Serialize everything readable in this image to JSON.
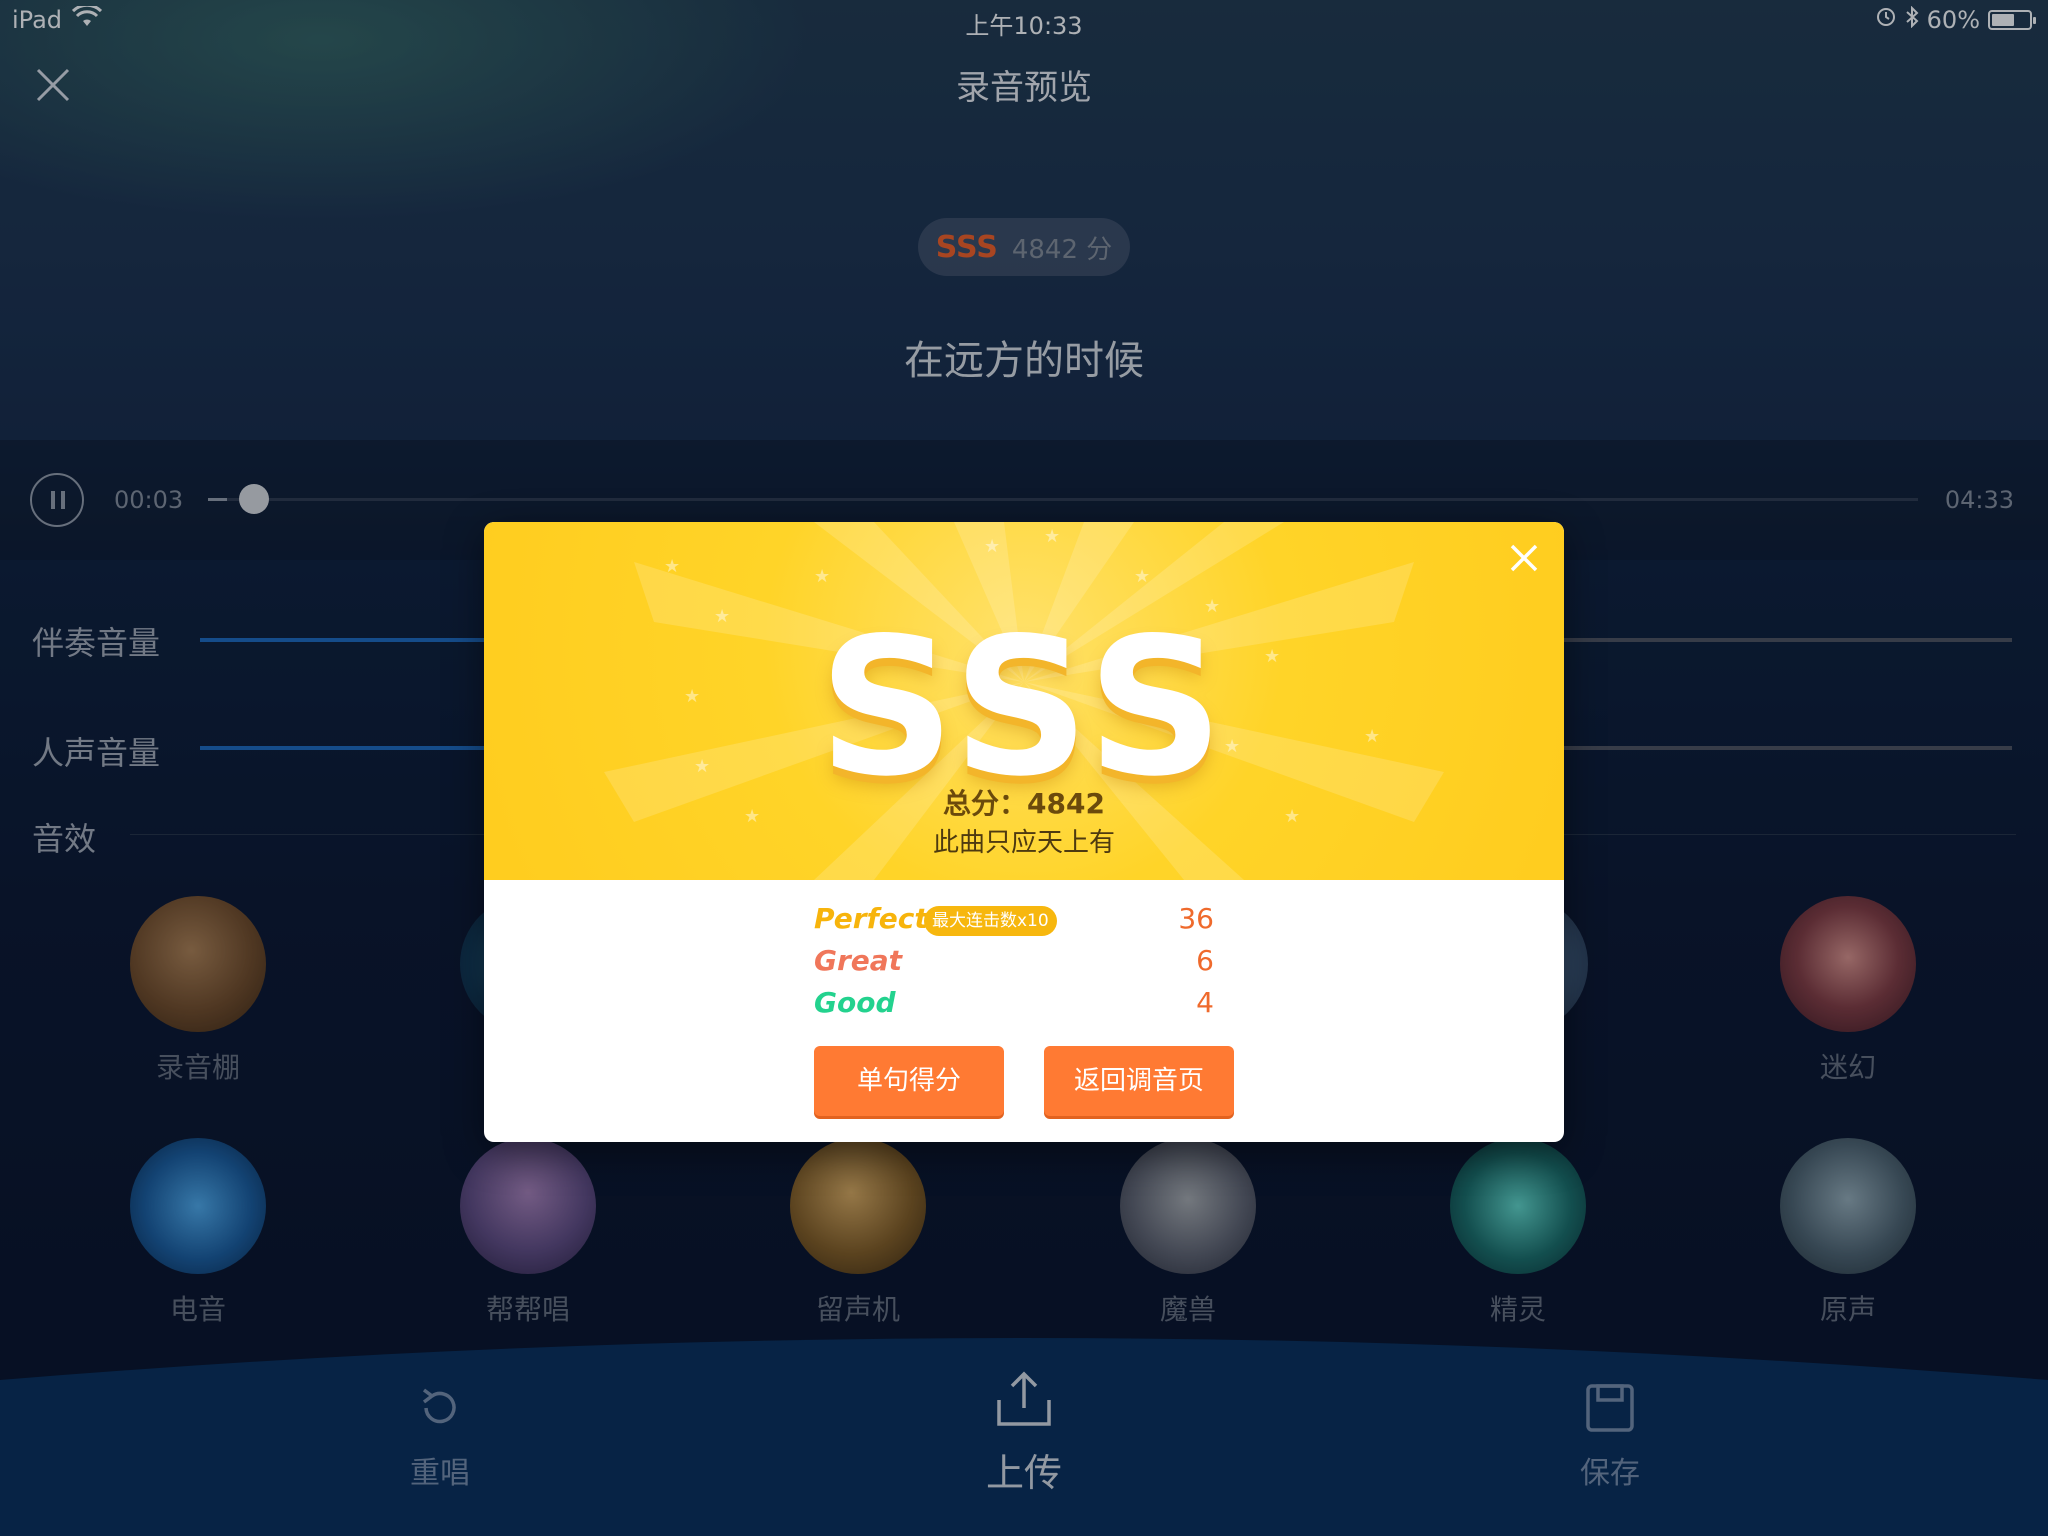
{
  "status_bar": {
    "carrier": "iPad",
    "time": "上午10:33",
    "battery": "60%"
  },
  "header": {
    "title": "录音预览"
  },
  "score": {
    "grade": "SSS",
    "points": "4842 分"
  },
  "lyric": "在远方的时候",
  "player": {
    "current_time": "00:03",
    "total_time": "04:33",
    "progress": 0.011
  },
  "volume": {
    "accompaniment_label": "伴奏音量",
    "vocal_label": "人声音量",
    "accompaniment_level": 0.6,
    "vocal_level": 0.6
  },
  "effects": {
    "label": "音效",
    "items": [
      {
        "name": "录音棚"
      },
      {
        "name": ""
      },
      {
        "name": ""
      },
      {
        "name": ""
      },
      {
        "name": ""
      },
      {
        "name": "迷幻"
      },
      {
        "name": "电音"
      },
      {
        "name": "帮帮唱"
      },
      {
        "name": "留声机"
      },
      {
        "name": "魔兽"
      },
      {
        "name": "精灵"
      },
      {
        "name": "原声"
      }
    ]
  },
  "actions": {
    "resing": "重唱",
    "upload": "上传",
    "save": "保存"
  },
  "result_modal": {
    "grade": "SSS",
    "total": "总分：4842",
    "comment": "此曲只应天上有",
    "stats": [
      {
        "label": "Perfect",
        "badge": "最大连击数x10",
        "value": "36",
        "color": "#f7b40c"
      },
      {
        "label": "Great",
        "value": "6",
        "color": "#f0765a"
      },
      {
        "label": "Good",
        "value": "4",
        "color": "#23d28e"
      }
    ],
    "buttons": {
      "sentence_score": "单句得分",
      "back_to_tuning": "返回调音页"
    }
  },
  "colors": {
    "accent_orange": "#ff7a33",
    "modal_yellow": "#ffd428",
    "slider_blue": "#1c66b8",
    "bottom_bar": "#0a2f5c"
  },
  "icons": [
    "wifi-icon",
    "alarm-icon",
    "bluetooth-icon",
    "battery-icon",
    "close-icon",
    "pause-icon",
    "resing-icon",
    "upload-icon",
    "save-icon"
  ]
}
